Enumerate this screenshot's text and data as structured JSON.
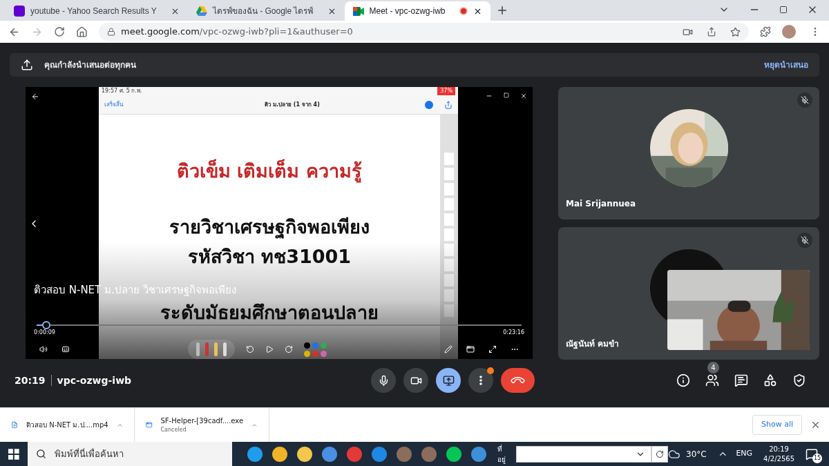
{
  "browser": {
    "tabs": [
      {
        "title": "youtube - Yahoo Search Results Y",
        "kind": "yahoo",
        "selected": false,
        "recording": false
      },
      {
        "title": "ไดรฟ์ของฉัน - Google ไดรฟ์",
        "kind": "drive",
        "selected": false,
        "recording": false
      },
      {
        "title": "Meet - vpc-ozwg-iwb",
        "kind": "meet",
        "selected": true,
        "recording": true
      }
    ],
    "url": {
      "host": "meet.google.com",
      "path": "/vpc-ozwg-iwb?pli=1&authuser=0"
    }
  },
  "banner": {
    "text": "คุณกำลังนำเสนอต่อทุกคน",
    "action": "หยุดนำเสนอ"
  },
  "presentation": {
    "status_time": "19:57  ศ. 5 ก.พ.",
    "battery": "37%",
    "done": "เสร็จสิ้น",
    "doc_title": "ติว ม.ปลาย (1 จาก 4)",
    "slide_lines": [
      {
        "text": "ติวเข็ม  เติมเต็ม ความรู้",
        "kind": "heading"
      },
      {
        "text": "รายวิชาเศรษฐกิจพอเพียง",
        "kind": "body"
      },
      {
        "text": "รหัสวิชา ทช31001",
        "kind": "body"
      },
      {
        "text": "ระดับมัธยมศึกษาตอนปลาย",
        "kind": "body"
      }
    ],
    "caption": "ติวสอบ N-NET  ม.ปลาย วิชาเศรษฐกิจพอเพียง",
    "elapsed": "0:00:09",
    "total": "0:23:16",
    "level": 0.012
  },
  "participants": [
    {
      "name": "Mai Srijannuea",
      "muted": true,
      "self_view": false
    },
    {
      "name": "ณัฐนันท์ คมขำ",
      "muted": true,
      "self_view": true
    }
  ],
  "meeting_bar": {
    "time": "20:19",
    "code": "vpc-ozwg-iwb",
    "presenting": true,
    "more_alert": true,
    "people_count": "4"
  },
  "downloads": [
    {
      "name": "ติวสอบ N-NET  ม.ป....mp4",
      "kind": "video"
    },
    {
      "name": "SF-Helper-[39cadf....exe",
      "kind": "app",
      "status": "Canceled"
    }
  ],
  "show_all": "Show all",
  "taskbar": {
    "search_placeholder": "พิมพ์ที่นี่เพื่อค้นหา",
    "address_label": "ที่อยู่",
    "temperature": "30°C",
    "language": "ENG",
    "time": "20:19",
    "date": "4/2/2565",
    "notifications": "15"
  }
}
